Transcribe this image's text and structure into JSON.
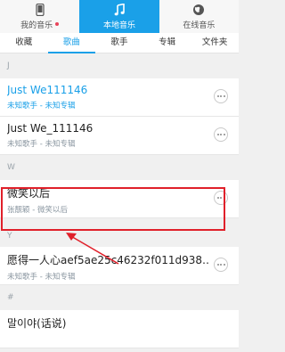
{
  "top_tabs": [
    {
      "label": "我的音乐",
      "icon": "phone-icon",
      "has_dot": true
    },
    {
      "label": "本地音乐",
      "icon": "music-note-icon",
      "active": true
    },
    {
      "label": "在线音乐",
      "icon": "globe-icon"
    }
  ],
  "sub_tabs": [
    "收藏",
    "歌曲",
    "歌手",
    "专辑",
    "文件夹"
  ],
  "active_sub_tab": "歌曲",
  "sections": [
    {
      "header": "J",
      "items": [
        {
          "title": "Just We111146",
          "subtitle": "未知歌手 - 未知专辑",
          "playing": true
        },
        {
          "title": "Just We_111146",
          "subtitle": "未知歌手 - 未知专辑"
        }
      ]
    },
    {
      "header": "W",
      "items": [
        {
          "title": "微笑以后",
          "subtitle": "张靓颖 - 微笑以后",
          "highlighted": true
        }
      ]
    },
    {
      "header": "Y",
      "items": [
        {
          "title": "愿得一人心aef5ae25c46232f011d938…",
          "subtitle": "未知歌手 - 未知专辑"
        }
      ]
    },
    {
      "header": "#",
      "items": [
        {
          "title": "말이야(话说)",
          "subtitle": ""
        }
      ]
    }
  ],
  "colors": {
    "accent": "#1aa0e8",
    "highlight_box": "#e0202a"
  }
}
